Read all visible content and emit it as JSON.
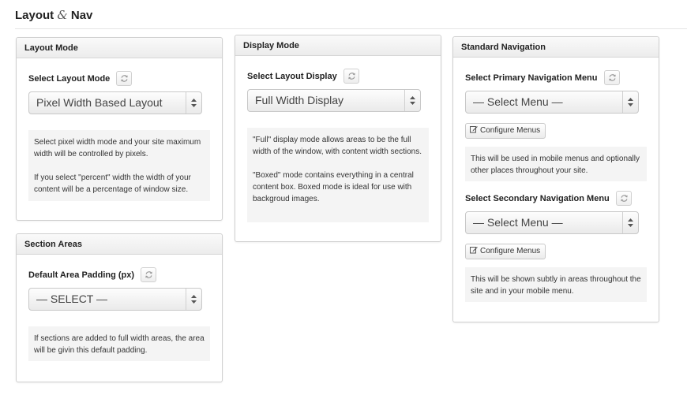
{
  "page": {
    "title_part1": "Layout",
    "title_amp": "&",
    "title_part2": "Nav"
  },
  "layout_mode": {
    "header": "Layout Mode",
    "label": "Select Layout Mode",
    "select_value": "Pixel Width Based Layout",
    "help": [
      "Select pixel width mode and your site maximum width will be controlled by pixels.",
      "If you select \"percent\" width the width of your content will be a percentage of window size."
    ]
  },
  "section_areas": {
    "header": "Section Areas",
    "label": "Default Area Padding (px)",
    "select_value": "— SELECT —",
    "help": [
      "If sections are added to full width areas, the area will be givin this default padding."
    ]
  },
  "display_mode": {
    "header": "Display Mode",
    "label": "Select Layout Display",
    "select_value": "Full Width Display",
    "help": [
      "\"Full\" display mode allows areas to be the full width of the window, with content width sections.",
      "\"Boxed\" mode contains everything in a central content box. Boxed mode is ideal for use with backgroud images."
    ]
  },
  "standard_navigation": {
    "header": "Standard Navigation",
    "primary": {
      "label": "Select Primary Navigation Menu",
      "select_value": "— Select Menu —",
      "button": "Configure Menus",
      "help": "This will be used in mobile menus and optionally other places throughout your site."
    },
    "secondary": {
      "label": "Select Secondary Navigation Menu",
      "select_value": "— Select Menu —",
      "button": "Configure Menus",
      "help": "This will be shown subtly in areas throughout the site and in your mobile menu."
    }
  },
  "icons": {
    "refresh": "refresh-icon",
    "select_arrows": "select-arrows-icon",
    "edit": "edit-icon"
  },
  "colors": {
    "panel_border": "#cfcfcf",
    "help_bg": "#f4f4f4",
    "header_bg": "#ececec"
  }
}
